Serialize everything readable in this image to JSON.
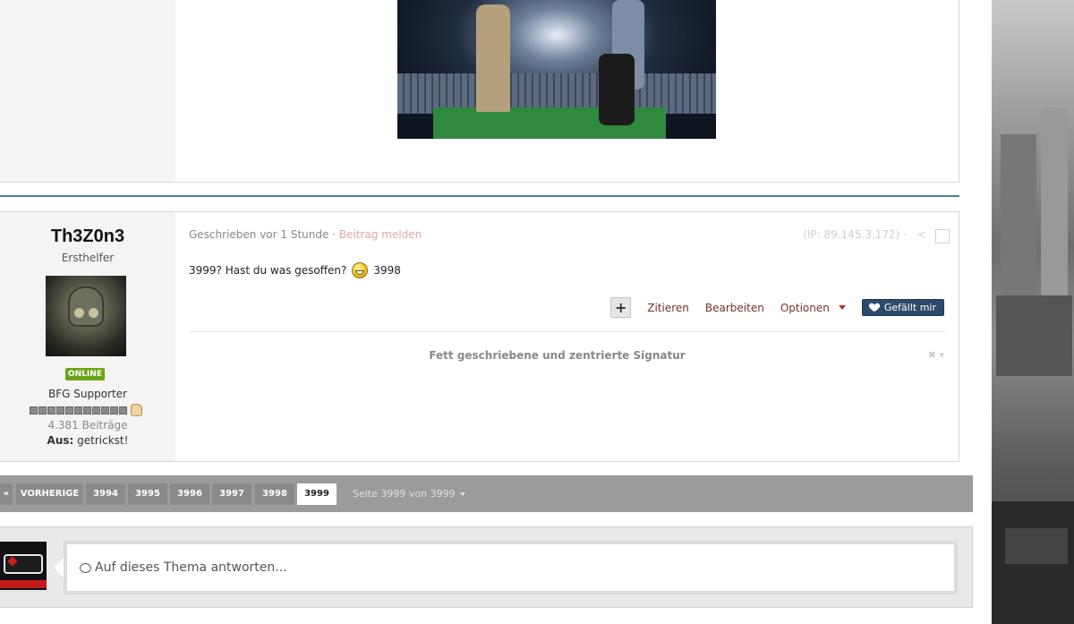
{
  "post": {
    "author": {
      "name": "Th3Z0n3",
      "rank": "Ersthelfer",
      "status_badge": "ONLINE",
      "group": "BFG Supporter",
      "posts_count": "4.381 Beiträge",
      "away_label": "Aus:",
      "away_value": "getrickst!"
    },
    "meta": {
      "written": "Geschrieben vor 1 Stunde",
      "separator": "·",
      "report": "Beitrag melden",
      "ip": "(IP: 89.145.3.172)",
      "ip_separator": "·"
    },
    "content": {
      "text_before": "3999? Hast du was gesoffen?",
      "smiley": "grin-smiley-icon",
      "text_after": "3998"
    },
    "actions": {
      "plus": "+",
      "quote": "Zitieren",
      "edit": "Bearbeiten",
      "options": "Optionen",
      "like": "Gefällt mir"
    },
    "signature": "Fett geschriebene und zentrierte Signatur"
  },
  "pagination": {
    "first": "«",
    "prev": "VORHERIGE",
    "pages": [
      "3994",
      "3995",
      "3996",
      "3997",
      "3998",
      "3999"
    ],
    "active_page": "3999",
    "info": "Seite 3999 von 3999"
  },
  "reply": {
    "placeholder": "Auf dieses Thema antworten..."
  },
  "colors": {
    "accent_link": "#7a2f2f",
    "like_button": "#2e4a6a",
    "online_badge": "#6aa519",
    "separator_line": "#4a7f9e",
    "pagination_bar": "#9b9b9b"
  }
}
